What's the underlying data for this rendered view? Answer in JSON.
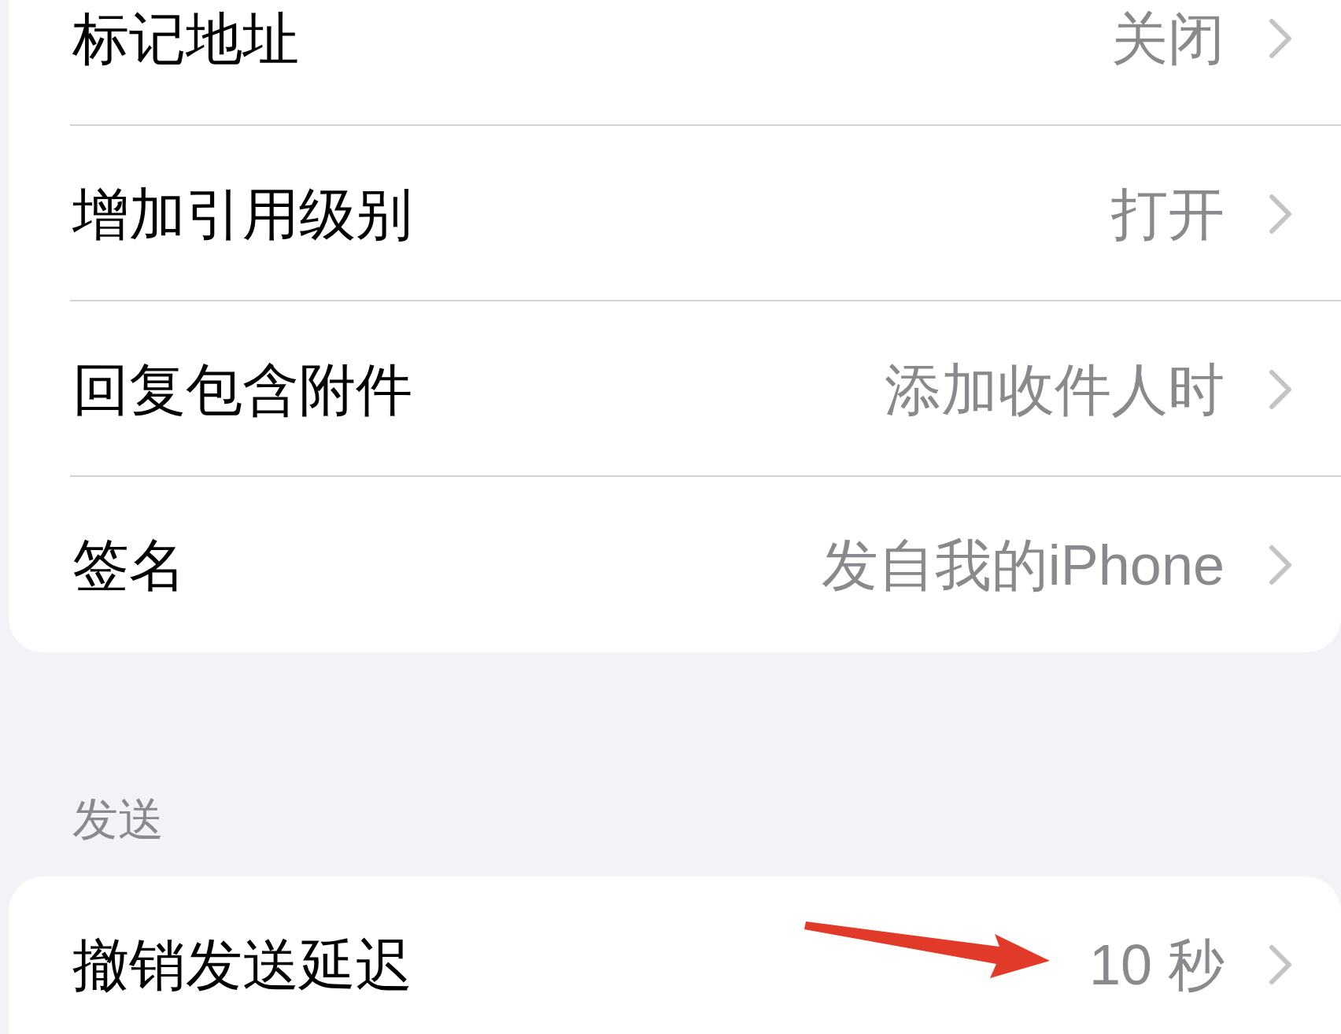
{
  "sections": [
    {
      "rows": [
        {
          "label": "标记地址",
          "value": "关闭"
        },
        {
          "label": "增加引用级别",
          "value": "打开"
        },
        {
          "label": "回复包含附件",
          "value": "添加收件人时"
        },
        {
          "label": "签名",
          "value": "发自我的iPhone"
        }
      ]
    },
    {
      "header": "发送",
      "rows": [
        {
          "label": "撤销发送延迟",
          "value": "10 秒"
        }
      ]
    }
  ]
}
